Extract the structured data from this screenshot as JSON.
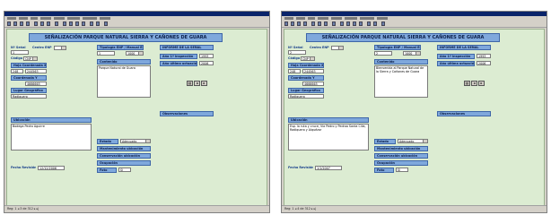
{
  "form_title": "SEÑALIZACIÓN PARQUE NATURAL SIERRA Y CAÑONES DE GUARA",
  "labels": {
    "n_senal": "Nº Señal",
    "centro_enp": "Centro ENP",
    "tipologia": "Tipología ENP / Manual ENP",
    "informe": "INFORME DE LA SEÑAL",
    "codigo": "Código",
    "ano_1_inspeccion": "Año 1ª inspección",
    "ano_ultima_actuacion": "Año última actuación",
    "hoja": "Hoja",
    "coordenada_x": "Coordenada X",
    "coordenada_y": "Coordenada Y",
    "lugar_geografico": "Lugar Geográfico",
    "contenido": "Contenido",
    "ubicacion": "Ubicación",
    "observaciones": "Observaciones",
    "estado": "Estado",
    "mantenimiento": "Mantenimiento ubicación",
    "conservacion": "Conservación ubicación",
    "ocupacion": "Ocupación",
    "foto": "Foto",
    "fecha_revision": "Fecha Revisión"
  },
  "records": [
    {
      "n_senal": "1",
      "centro_enp": "",
      "tipologia": "",
      "codigo": "CNP",
      "tipologia_num": "1",
      "tipologia_code": "1000",
      "ano_1": "1993",
      "ano_ultima": "2006",
      "hoja": "248",
      "coord_x": "244563",
      "coord_y": "4666665",
      "lugar": "Radiquero",
      "contenido": "Parque Natural de Guara",
      "ubicacion": "Bodega Pedro Aguirre",
      "estado": "Adecuado",
      "mantenimiento": "",
      "conservacion": "",
      "ocupacion": "",
      "foto": "Sí",
      "fecha": "12/12/2006",
      "status": "Reg: 1 ◂ 3 de 312 ▸ ▸|"
    },
    {
      "n_senal": "2",
      "centro_enp": "",
      "tipologia": "",
      "codigo": "CNP",
      "tipologia_num": "2",
      "tipologia_code": "1000",
      "ano_1": "1993",
      "ano_ultima": "2006",
      "hoja": "248",
      "coord_x": "244563",
      "coord_y": "4666665",
      "lugar": "Radiquero",
      "contenido": "Bienvenida al Parque Natural de la Sierra y Cañones de Guara",
      "ubicacion": "Esp. la ruta y cruce, Vía Pedro y Pedroa Santa Cilia, Radiquero y Alquézar",
      "estado": "Adecuado",
      "mantenimiento": "",
      "conservacion": "",
      "ocupacion": "",
      "foto": "Sí",
      "fecha": "1/1/2007",
      "status": "Reg: 1 ◂ 4 de 312 ▸ ▸|"
    }
  ],
  "colors": {
    "form_bg": "#dcecd2",
    "label_blue": "#7fa8dc",
    "label_border": "#3e66a8",
    "titlebar": "#0a246a"
  }
}
